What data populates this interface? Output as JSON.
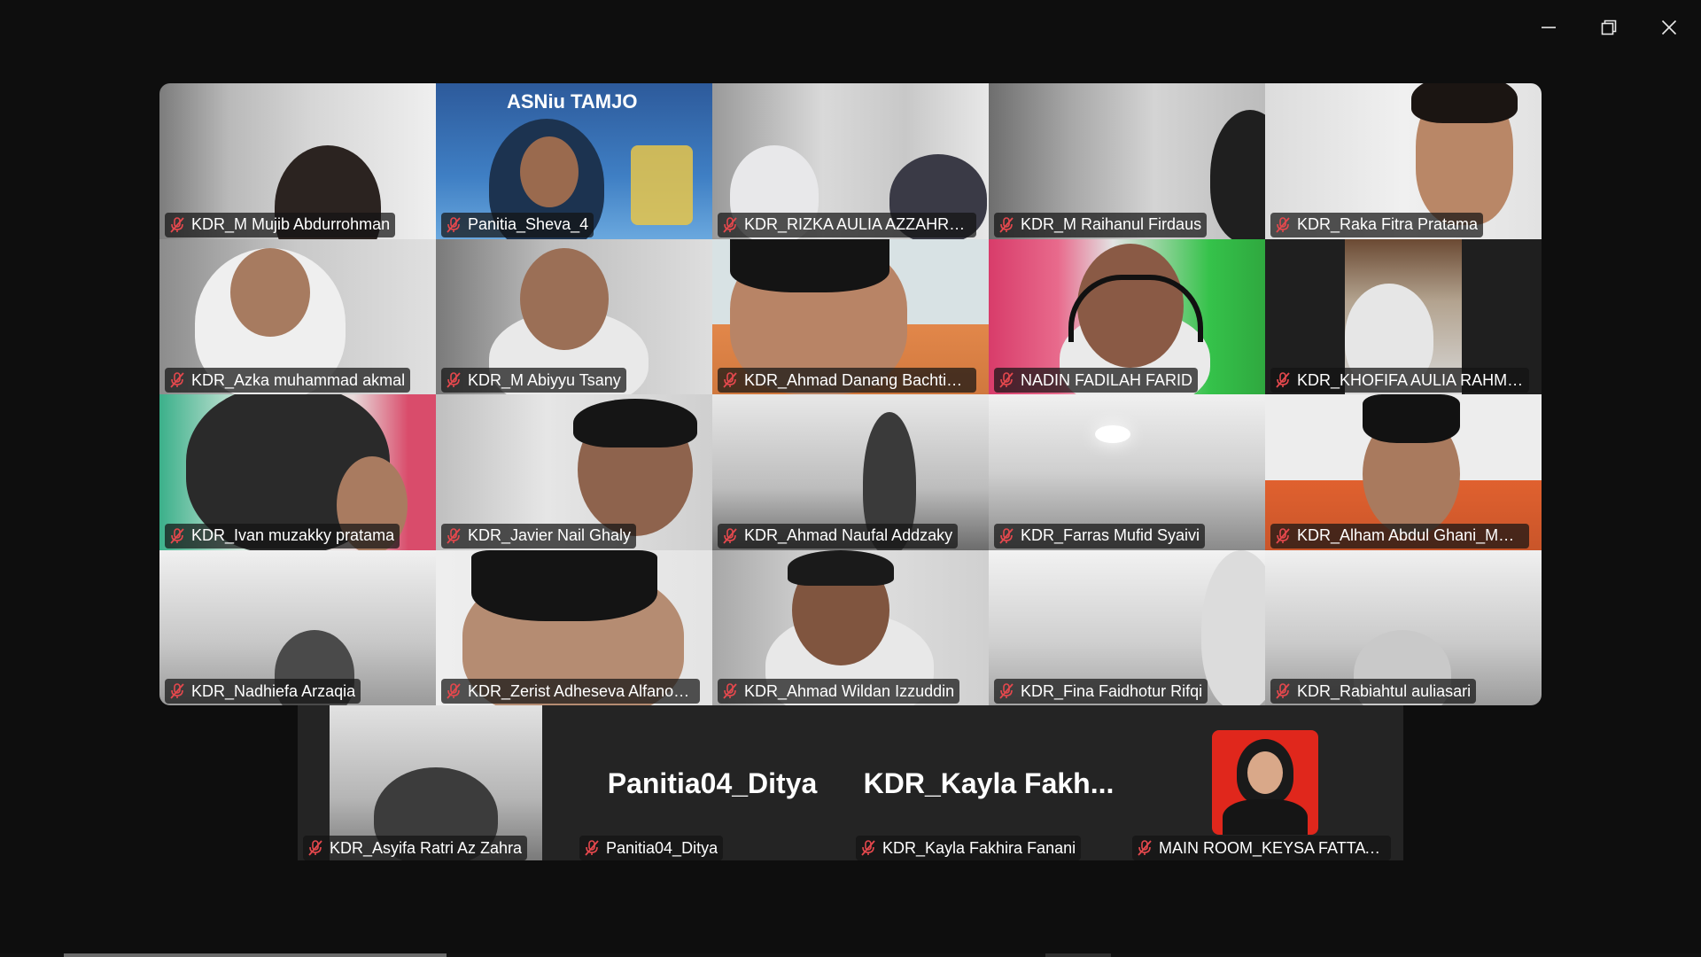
{
  "window_controls": {
    "minimize_icon": "minimize-icon",
    "restore_icon": "restore-icon",
    "close_icon": "close-icon"
  },
  "participants": [
    {
      "name": "KDR_M Mujib Abdurrohman",
      "muted": true
    },
    {
      "name": "Panitia_Sheva_4",
      "muted": true,
      "background_text": "ASNiu TAMJO"
    },
    {
      "name": "KDR_RIZKA AULIA AZZAHROH,...",
      "muted": true
    },
    {
      "name": "KDR_M Raihanul Firdaus",
      "muted": true
    },
    {
      "name": "KDR_Raka Fitra Pratama",
      "muted": true
    },
    {
      "name": "KDR_Azka muhammad akmal",
      "muted": true
    },
    {
      "name": "KDR_M Abiyyu Tsany",
      "muted": true
    },
    {
      "name": "KDR_Ahmad Danang Bachtia_...",
      "muted": true,
      "active_speaker": true
    },
    {
      "name": "NADIN FADILAH FARID",
      "muted": true
    },
    {
      "name": "KDR_KHOFIFA AULIA RAHMAW...",
      "muted": true
    },
    {
      "name": "KDR_Ivan muzakky pratama",
      "muted": true
    },
    {
      "name": "KDR_Javier Nail Ghaly",
      "muted": true
    },
    {
      "name": "KDR_Ahmad Naufal Addzaky",
      "muted": true
    },
    {
      "name": "KDR_Farras Mufid Syaivi",
      "muted": true
    },
    {
      "name": "KDR_Alham Abdul Ghani_MAN ...",
      "muted": true
    },
    {
      "name": "KDR_Nadhiefa Arzaqia",
      "muted": true
    },
    {
      "name": "KDR_Zerist Adheseva Alfano_M...",
      "muted": true
    },
    {
      "name": "KDR_Ahmad Wildan Izzuddin",
      "muted": true
    },
    {
      "name": "KDR_Fina Faidhotur Rifqi",
      "muted": true
    },
    {
      "name": "KDR_Rabiahtul auliasari",
      "muted": true
    }
  ],
  "bottom_participants": [
    {
      "name": "KDR_Asyifa Ratri Az Zahra",
      "muted": true,
      "video": true
    },
    {
      "name": "Panitia04_Ditya",
      "muted": true,
      "video": false,
      "display_name": "Panitia04_Ditya"
    },
    {
      "name": "KDR_Kayla Fakhira Fanani",
      "muted": true,
      "video": false,
      "display_name": "KDR_Kayla  Fakh..."
    },
    {
      "name": "MAIN ROOM_KEYSA FATTAYA Y",
      "muted": true,
      "video": false,
      "has_profile_photo": true
    }
  ],
  "colors": {
    "background": "#0e0e0e",
    "tile_background": "#242424",
    "active_speaker_border": "#23d96b",
    "mute_icon": "#e5484d",
    "profile_photo_bg": "#e0271c"
  }
}
